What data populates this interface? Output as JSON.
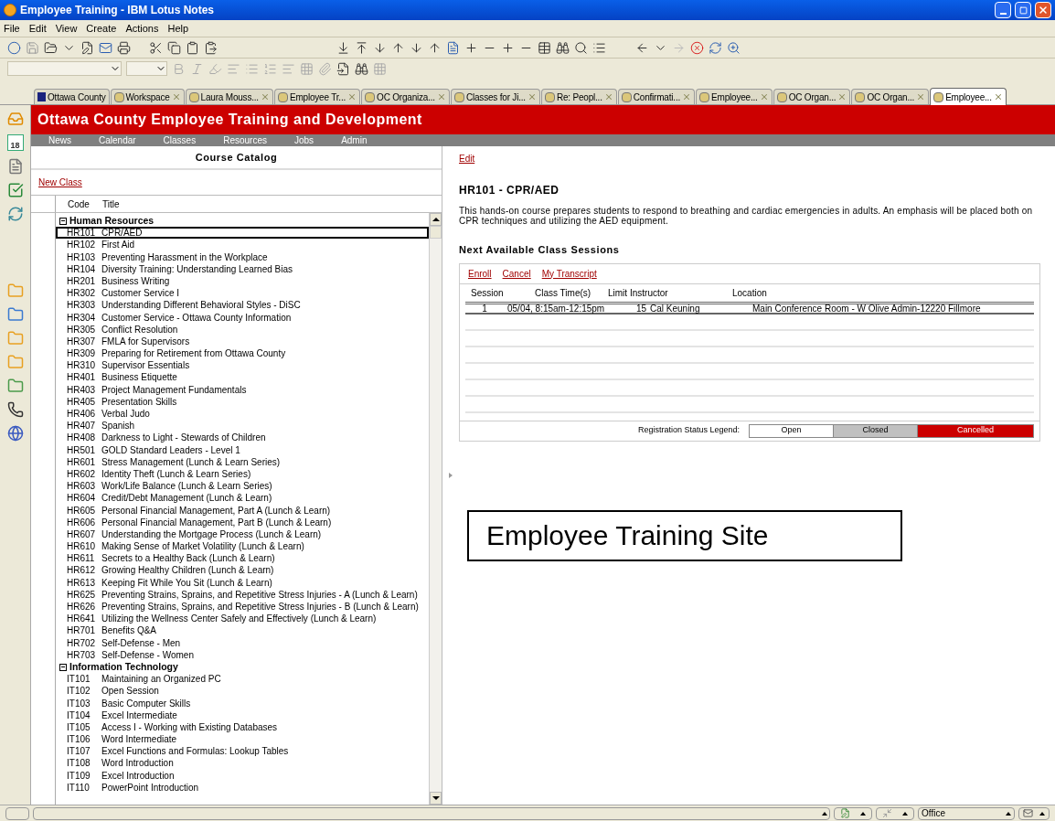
{
  "window": {
    "title": "Employee Training - IBM Lotus Notes"
  },
  "menu": [
    "File",
    "Edit",
    "View",
    "Create",
    "Actions",
    "Help"
  ],
  "tabs": [
    {
      "label": "Ottawa County",
      "closable": false,
      "selected": false
    },
    {
      "label": "Workspace",
      "closable": true,
      "selected": false
    },
    {
      "label": "Laura Mouss...",
      "closable": true,
      "selected": false
    },
    {
      "label": "Employee Tr...",
      "closable": true,
      "selected": false
    },
    {
      "label": "OC Organiza...",
      "closable": true,
      "selected": false
    },
    {
      "label": "Classes for Ji...",
      "closable": true,
      "selected": false
    },
    {
      "label": "Re: Peopl...",
      "closable": true,
      "selected": false
    },
    {
      "label": "Confirmati...",
      "closable": true,
      "selected": false
    },
    {
      "label": "Employee...",
      "closable": true,
      "selected": false
    },
    {
      "label": "OC Organ...",
      "closable": true,
      "selected": false
    },
    {
      "label": "OC Organ...",
      "closable": true,
      "selected": false
    },
    {
      "label": "Employee...",
      "closable": true,
      "selected": true
    }
  ],
  "sidebar": {
    "calendar_day": "18"
  },
  "header": {
    "title": "Ottawa County Employee Training and Development",
    "nav": [
      "News",
      "Calendar",
      "Classes",
      "Resources",
      "Jobs",
      "Admin"
    ]
  },
  "catalog": {
    "title": "Course Catalog",
    "new_class_link": "New Class",
    "columns": [
      "Code",
      "Title"
    ],
    "groups": [
      {
        "name": "Human Resources",
        "expanded": true,
        "courses": [
          {
            "code": "HR101",
            "title": "CPR/AED",
            "selected": true
          },
          {
            "code": "HR102",
            "title": "First Aid",
            "selected": false
          },
          {
            "code": "HR103",
            "title": "Preventing Harassment in the Workplace",
            "selected": false
          },
          {
            "code": "HR104",
            "title": "Diversity Training: Understanding Learned Bias",
            "selected": false
          },
          {
            "code": "HR201",
            "title": "Business Writing",
            "selected": false
          },
          {
            "code": "HR302",
            "title": "Customer Service I",
            "selected": false
          },
          {
            "code": "HR303",
            "title": "Understanding Different Behavioral Styles - DiSC",
            "selected": false
          },
          {
            "code": "HR304",
            "title": "Customer Service - Ottawa County Information",
            "selected": false
          },
          {
            "code": "HR305",
            "title": "Conflict Resolution",
            "selected": false
          },
          {
            "code": "HR307",
            "title": "FMLA for Supervisors",
            "selected": false
          },
          {
            "code": "HR309",
            "title": "Preparing for Retirement from Ottawa County",
            "selected": false
          },
          {
            "code": "HR310",
            "title": "Supervisor Essentials",
            "selected": false
          },
          {
            "code": "HR401",
            "title": "Business Etiquette",
            "selected": false
          },
          {
            "code": "HR403",
            "title": "Project Management Fundamentals",
            "selected": false
          },
          {
            "code": "HR405",
            "title": "Presentation Skills",
            "selected": false
          },
          {
            "code": "HR406",
            "title": "Verbal Judo",
            "selected": false
          },
          {
            "code": "HR407",
            "title": "Spanish",
            "selected": false
          },
          {
            "code": "HR408",
            "title": "Darkness to Light - Stewards of Children",
            "selected": false
          },
          {
            "code": "HR501",
            "title": "GOLD Standard Leaders - Level 1",
            "selected": false
          },
          {
            "code": "HR601",
            "title": "Stress Management (Lunch & Learn Series)",
            "selected": false
          },
          {
            "code": "HR602",
            "title": "Identity Theft (Lunch & Learn Series)",
            "selected": false
          },
          {
            "code": "HR603",
            "title": "Work/Life Balance (Lunch & Learn Series)",
            "selected": false
          },
          {
            "code": "HR604",
            "title": "Credit/Debt Management (Lunch & Learn)",
            "selected": false
          },
          {
            "code": "HR605",
            "title": "Personal Financial Management, Part A (Lunch & Learn)",
            "selected": false
          },
          {
            "code": "HR606",
            "title": "Personal Financial Management, Part B (Lunch & Learn)",
            "selected": false
          },
          {
            "code": "HR607",
            "title": "Understanding the Mortgage Process (Lunch & Learn)",
            "selected": false
          },
          {
            "code": "HR610",
            "title": "Making Sense of Market Volatility (Lunch & Learn)",
            "selected": false
          },
          {
            "code": "HR611",
            "title": "Secrets to a Healthy Back (Lunch & Learn)",
            "selected": false
          },
          {
            "code": "HR612",
            "title": "Growing Healthy Children (Lunch & Learn)",
            "selected": false
          },
          {
            "code": "HR613",
            "title": "Keeping Fit While You Sit (Lunch & Learn)",
            "selected": false
          },
          {
            "code": "HR625",
            "title": "Preventing Strains, Sprains, and Repetitive Stress Injuries - A (Lunch & Learn)",
            "selected": false
          },
          {
            "code": "HR626",
            "title": "Preventing Strains, Sprains, and Repetitive Stress Injuries - B (Lunch & Learn)",
            "selected": false
          },
          {
            "code": "HR641",
            "title": "Utilizing the Wellness Center Safely and Effectively (Lunch & Learn)",
            "selected": false
          },
          {
            "code": "HR701",
            "title": "Benefits Q&A",
            "selected": false
          },
          {
            "code": "HR702",
            "title": "Self-Defense - Men",
            "selected": false
          },
          {
            "code": "HR703",
            "title": "Self-Defense - Women",
            "selected": false
          }
        ]
      },
      {
        "name": "Information Technology",
        "expanded": true,
        "courses": [
          {
            "code": "IT101",
            "title": "Maintaining an Organized PC",
            "selected": false
          },
          {
            "code": "IT102",
            "title": "Open Session",
            "selected": false
          },
          {
            "code": "IT103",
            "title": "Basic Computer Skills",
            "selected": false
          },
          {
            "code": "IT104",
            "title": "Excel Intermediate",
            "selected": false
          },
          {
            "code": "IT105",
            "title": "Access I - Working with Existing Databases",
            "selected": false
          },
          {
            "code": "IT106",
            "title": "Word Intermediate",
            "selected": false
          },
          {
            "code": "IT107",
            "title": "Excel Functions and Formulas: Lookup Tables",
            "selected": false
          },
          {
            "code": "IT108",
            "title": "Word Introduction",
            "selected": false
          },
          {
            "code": "IT109",
            "title": "Excel Introduction",
            "selected": false
          },
          {
            "code": "IT110",
            "title": "PowerPoint Introduction",
            "selected": false
          }
        ]
      }
    ]
  },
  "detail": {
    "edit_link": "Edit",
    "heading": "HR101 - CPR/AED",
    "description": "This hands-on course prepares students to respond to breathing and cardiac emergencies in adults. An emphasis will be placed both on CPR techniques and utilizing the AED equipment.",
    "sessions_heading": "Next Available Class Sessions",
    "actions": [
      "Enroll",
      "Cancel",
      "My Transcript"
    ],
    "columns": [
      "Session",
      "Class Time(s)",
      "Limit",
      "Instructor",
      "Location"
    ],
    "rows": [
      {
        "session": "1",
        "time": "05/04, 8:15am-12:15pm",
        "limit": "15",
        "instructor": "Cal Keuning",
        "location": "Main Conference Room - W Olive Admin-12220 Fillmore"
      }
    ],
    "legend": {
      "label": "Registration Status Legend:",
      "items": [
        {
          "label": "Open",
          "color": "#ffffff"
        },
        {
          "label": "Closed",
          "color": "#c0c0c0"
        },
        {
          "label": "Cancelled",
          "color": "#cc0000"
        }
      ]
    }
  },
  "callout": {
    "text": "Employee Training Site"
  },
  "status_bar": {
    "location": "Office"
  }
}
